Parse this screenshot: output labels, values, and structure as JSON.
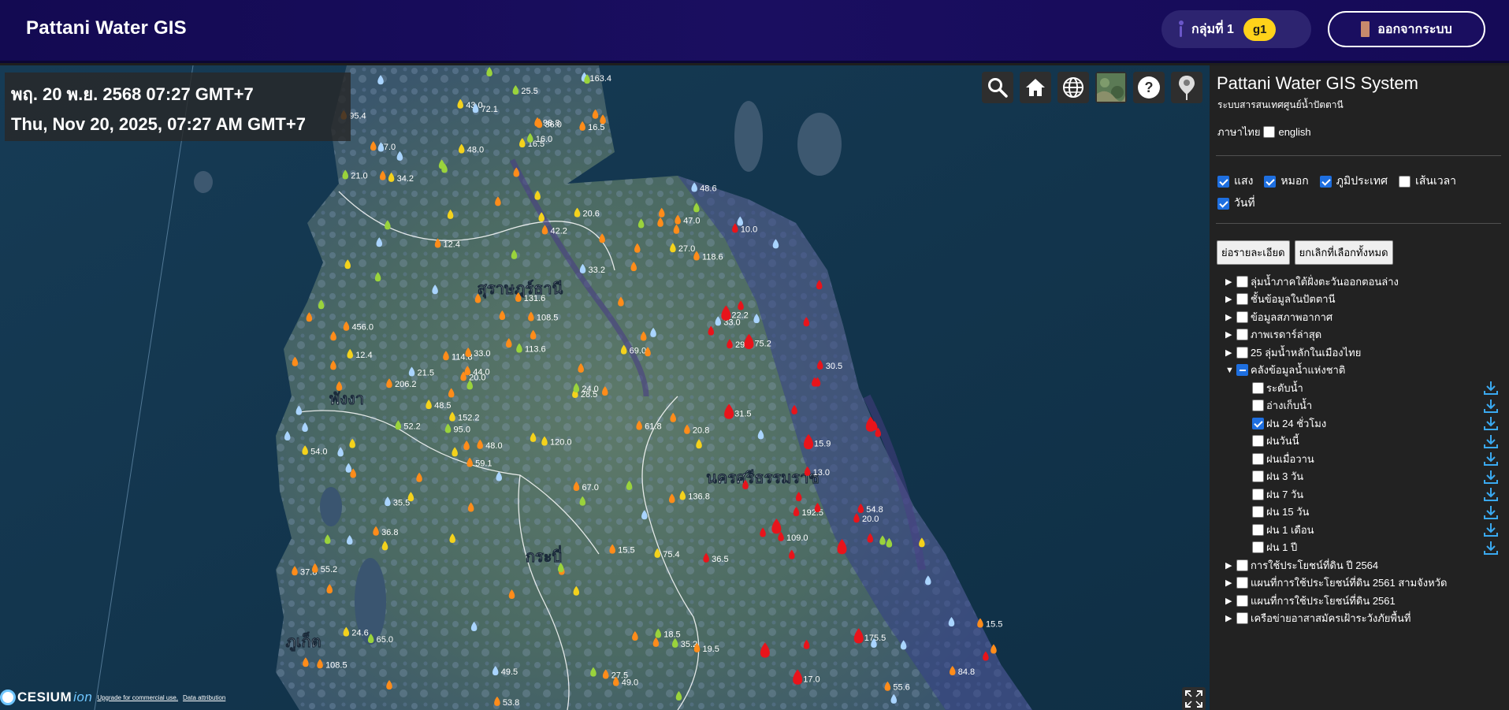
{
  "header": {
    "title": "Pattani Water GIS",
    "group_label": "กลุ่มที่ 1",
    "group_badge": "g1",
    "logout_label": "ออกจากระบบ"
  },
  "map": {
    "datetime_th": "พฤ. 20 พ.ย. 2568 07:27 GMT+7",
    "datetime_en": "Thu, Nov 20, 2025, 07:27 AM GMT+7",
    "toolbar": [
      "search-icon",
      "home-icon",
      "globe-icon",
      "imagery-icon",
      "help-icon",
      "pin-icon"
    ],
    "help_glyph": "?",
    "credits": {
      "logo_main": "CESIUM",
      "logo_ion": "ion",
      "upgrade": "Upgrade for commercial use.",
      "attribution": "Data attribution"
    },
    "province_labels": [
      "สุราษฎร์ธานี",
      "พังงา",
      "นครศรีธรรมราช",
      "กระบี่",
      "ภูเก็ต"
    ],
    "value_labels": [
      "61.8",
      "52.2",
      "108.5",
      "27.5",
      "136.8",
      "152.2",
      "98.8",
      "114.8",
      "113.6",
      "131.6",
      "109.0",
      "120.0",
      "175.5",
      "192.5",
      "206.2",
      "456.0",
      "163.4",
      "95.4",
      "54.0",
      "35.2",
      "65.0",
      "49.0",
      "48.5",
      "33.0",
      "21.0",
      "28.5",
      "20.6",
      "36.8",
      "27.0",
      "16.5",
      "15.9",
      "20.0",
      "17.0",
      "20.8",
      "22.2",
      "24.6",
      "43.0",
      "31.5",
      "15.5",
      "19.5",
      "35.5",
      "48.0",
      "36.0",
      "16.5",
      "33.2",
      "18.5",
      "30.5",
      "29.0",
      "15.5",
      "25.5",
      "12.4",
      "10.0",
      "13.0",
      "53.8",
      "95.0",
      "44.0",
      "36.5",
      "108.5",
      "84.8",
      "55.2",
      "69.0",
      "42.2",
      "34.2",
      "16.0",
      "24.0",
      "20.0",
      "72.1",
      "75.4",
      "67.0",
      "48.0",
      "67.0",
      "75.2",
      "54.8",
      "118.6",
      "48.6",
      "33.0",
      "55.6",
      "37.8",
      "49.5",
      "47.0",
      "59.1",
      "12.4",
      "21.5"
    ],
    "accent_colors": {
      "rain_high": "#e8141b",
      "rain_mid": "#ff8c1a",
      "rain_low": "#f4d21c",
      "rain_light": "#9ad33c",
      "rain_trace": "#a9d4ff"
    }
  },
  "panel": {
    "title": "Pattani Water GIS System",
    "subtitle": "ระบบสารสนเทศศูนย์น้ำปัตตานี",
    "lang_th": "ภาษาไทย",
    "lang_en": "english",
    "options": [
      {
        "label": "แสง",
        "checked": true
      },
      {
        "label": "หมอก",
        "checked": true
      },
      {
        "label": "ภูมิประเทศ",
        "checked": true
      },
      {
        "label": "เส้นเวลา",
        "checked": false
      },
      {
        "label": "วันที่",
        "checked": true
      }
    ],
    "collapse_btn": "ย่อรายละเอียด",
    "deselect_btn": "ยกเลิกที่เลือกทั้งหมด",
    "tree": [
      {
        "label": "ลุ่มน้ำภาคใต้ฝั่งตะวันออกตอนล่าง",
        "expanded": false,
        "state": "off"
      },
      {
        "label": "ชั้นข้อมูลในปัตตานี",
        "expanded": false,
        "state": "off"
      },
      {
        "label": "ข้อมูลสภาพอากาศ",
        "expanded": false,
        "state": "off"
      },
      {
        "label": "ภาพเรดาร์ล่าสุด",
        "expanded": false,
        "state": "off"
      },
      {
        "label": "25 ลุ่มน้ำหลักในเมืองไทย",
        "expanded": false,
        "state": "off"
      },
      {
        "label": "คลังข้อมูลน้ำแห่งชาติ",
        "expanded": true,
        "state": "mixed"
      }
    ],
    "children": [
      {
        "label": "ระดับน้ำ",
        "checked": false
      },
      {
        "label": "อ่างเก็บน้ำ",
        "checked": false
      },
      {
        "label": "ฝน 24 ชั่วโมง",
        "checked": true
      },
      {
        "label": "ฝนวันนี้",
        "checked": false
      },
      {
        "label": "ฝนเมื่อวาน",
        "checked": false
      },
      {
        "label": "ฝน 3 วัน",
        "checked": false
      },
      {
        "label": "ฝน 7 วัน",
        "checked": false
      },
      {
        "label": "ฝน 15 วัน",
        "checked": false
      },
      {
        "label": "ฝน 1 เดือน",
        "checked": false
      },
      {
        "label": "ฝน 1 ปี",
        "checked": false
      }
    ],
    "tree_after": [
      {
        "label": "การใช้ประโยชน์ที่ดิน ปี 2564",
        "expanded": false,
        "state": "off"
      },
      {
        "label": "แผนที่การใช้ประโยชน์ที่ดิน 2561 สามจังหวัด",
        "expanded": false,
        "state": "off"
      },
      {
        "label": "แผนที่การใช้ประโยชน์ที่ดิน 2561",
        "expanded": false,
        "state": "off"
      },
      {
        "label": "เครือข่ายอาสาสมัครเฝ้าระวังภัยพื้นที่",
        "expanded": false,
        "state": "off"
      }
    ]
  }
}
